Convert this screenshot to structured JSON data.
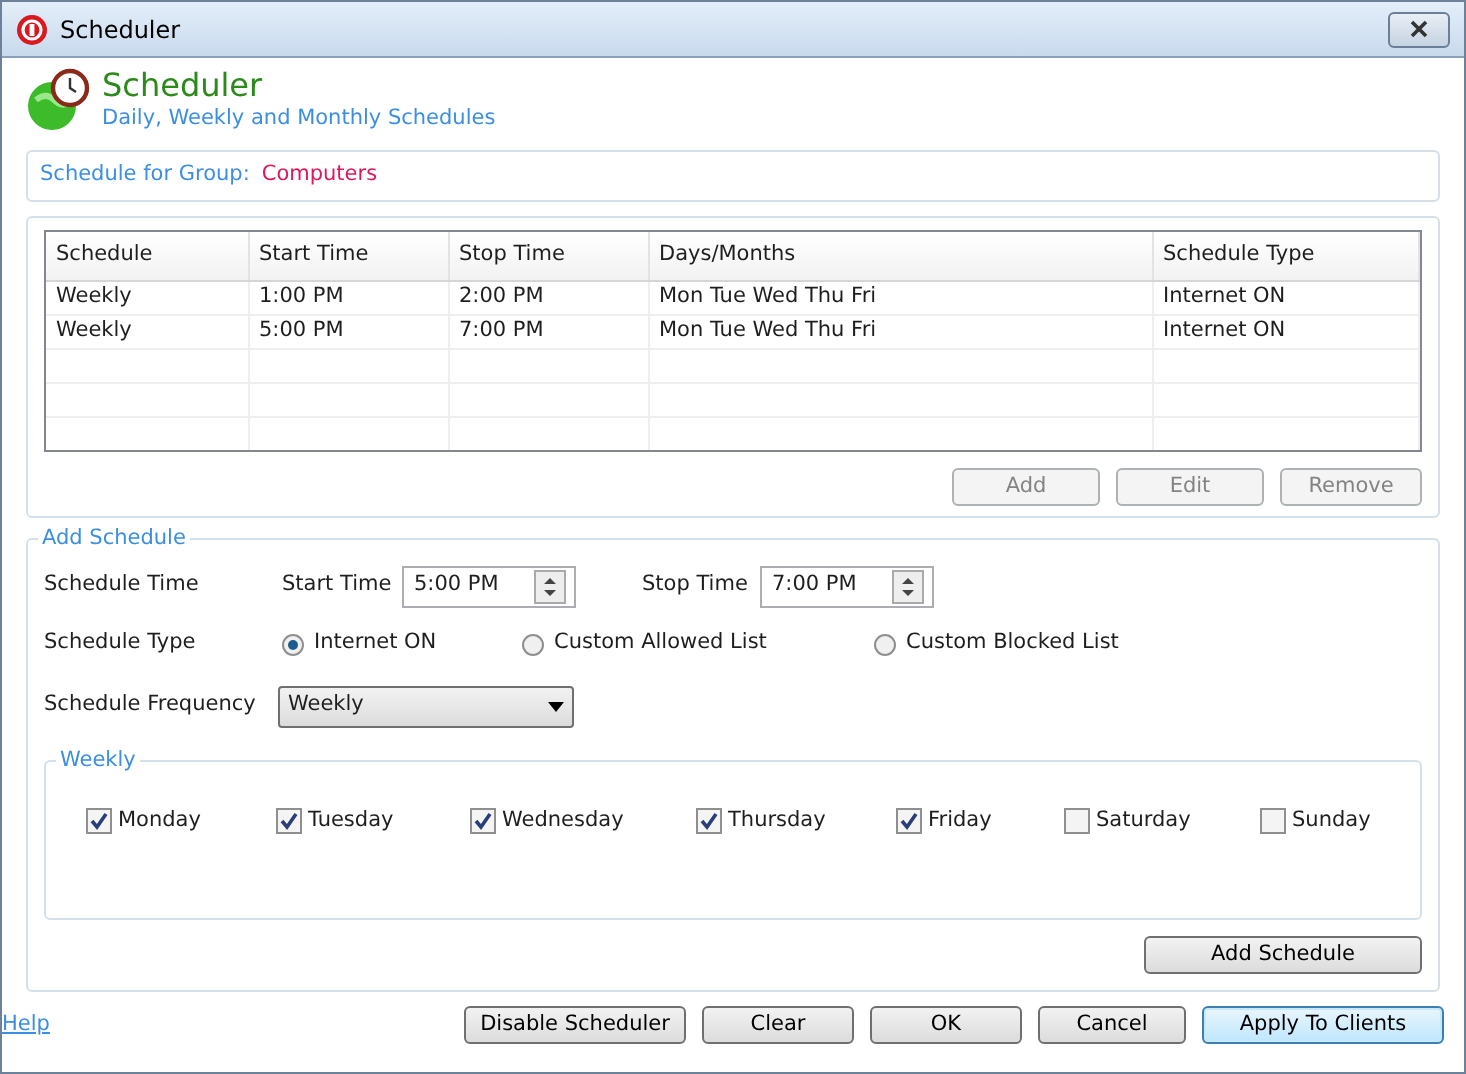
{
  "window": {
    "title": "Scheduler"
  },
  "header": {
    "title": "Scheduler",
    "subtitle": "Daily, Weekly and  Monthly Schedules"
  },
  "group": {
    "label": "Schedule for Group:",
    "value": "Computers"
  },
  "table": {
    "columns": [
      "Schedule",
      "Start Time",
      "Stop Time",
      "Days/Months",
      "Schedule Type"
    ],
    "rows": [
      [
        "Weekly",
        "1:00 PM",
        "2:00 PM",
        "Mon Tue Wed Thu Fri",
        "Internet ON"
      ],
      [
        "Weekly",
        "5:00 PM",
        "7:00 PM",
        "Mon Tue Wed Thu Fri",
        "Internet ON"
      ]
    ]
  },
  "table_buttons": [
    {
      "label": "Add",
      "disabled": true
    },
    {
      "label": "Edit",
      "disabled": true
    },
    {
      "label": "Remove",
      "disabled": true
    }
  ],
  "add_schedule": {
    "title": "Add Schedule",
    "time_label": "Schedule Time",
    "start": {
      "label": "Start Time",
      "value": "5:00 PM"
    },
    "stop": {
      "label": "Stop Time",
      "value": "7:00 PM"
    },
    "type_label": "Schedule Type",
    "types": [
      {
        "label": "Internet ON",
        "selected": true
      },
      {
        "label": "Custom Allowed List",
        "selected": false
      },
      {
        "label": "Custom Blocked List",
        "selected": false
      }
    ],
    "frequency_label": "Schedule Frequency",
    "frequency": "Weekly",
    "weekly": {
      "title": "Weekly",
      "days": [
        {
          "label": "Monday",
          "checked": true
        },
        {
          "label": "Tuesday",
          "checked": true
        },
        {
          "label": "Wednesday",
          "checked": true
        },
        {
          "label": "Thursday",
          "checked": true
        },
        {
          "label": "Friday",
          "checked": true
        },
        {
          "label": "Saturday",
          "checked": false
        },
        {
          "label": "Sunday",
          "checked": false
        }
      ]
    },
    "add_button": "Add Schedule"
  },
  "footer": {
    "help": "Help",
    "buttons": [
      {
        "label": "Disable Scheduler",
        "default": false
      },
      {
        "label": "Clear",
        "default": false
      },
      {
        "label": "OK",
        "default": false
      },
      {
        "label": "Cancel",
        "default": false
      },
      {
        "label": "Apply To Clients",
        "default": true
      }
    ]
  }
}
